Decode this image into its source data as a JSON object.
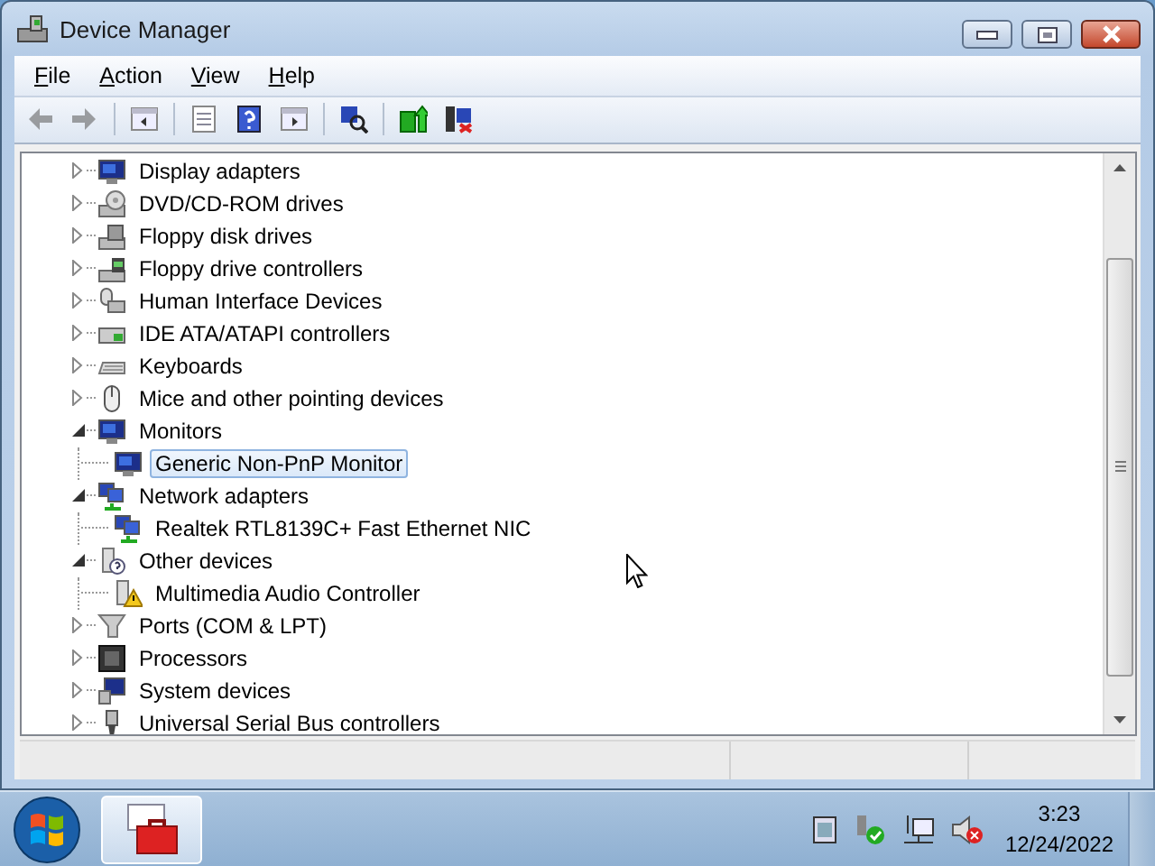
{
  "window": {
    "title": "Device Manager"
  },
  "menu": [
    {
      "label": "File"
    },
    {
      "label": "Action"
    },
    {
      "label": "View"
    },
    {
      "label": "Help"
    }
  ],
  "toolbar": [
    {
      "kind": "back",
      "disabled": true
    },
    {
      "kind": "forward",
      "disabled": true
    },
    {
      "kind": "tree",
      "disabled": false
    },
    {
      "kind": "properties",
      "disabled": false
    },
    {
      "kind": "help",
      "disabled": false
    },
    {
      "kind": "pane",
      "disabled": false
    },
    {
      "kind": "scan",
      "disabled": false
    },
    {
      "kind": "update",
      "disabled": false
    },
    {
      "kind": "uninstall",
      "disabled": false
    }
  ],
  "tree": [
    {
      "label": "Display adapters",
      "expanded": false
    },
    {
      "label": "DVD/CD-ROM drives",
      "expanded": false
    },
    {
      "label": "Floppy disk drives",
      "expanded": false
    },
    {
      "label": "Floppy drive controllers",
      "expanded": false
    },
    {
      "label": "Human Interface Devices",
      "expanded": false
    },
    {
      "label": "IDE ATA/ATAPI controllers",
      "expanded": false
    },
    {
      "label": "Keyboards",
      "expanded": false
    },
    {
      "label": "Mice and other pointing devices",
      "expanded": false
    },
    {
      "label": "Monitors",
      "expanded": true,
      "children": [
        {
          "label": "Generic Non-PnP Monitor",
          "selected": true,
          "warning": false
        }
      ]
    },
    {
      "label": "Network adapters",
      "expanded": true,
      "children": [
        {
          "label": "Realtek RTL8139C+ Fast Ethernet NIC",
          "selected": false,
          "warning": false
        }
      ]
    },
    {
      "label": "Other devices",
      "expanded": true,
      "children": [
        {
          "label": "Multimedia Audio Controller",
          "selected": false,
          "warning": true
        }
      ]
    },
    {
      "label": "Ports (COM & LPT)",
      "expanded": false
    },
    {
      "label": "Processors",
      "expanded": false
    },
    {
      "label": "System devices",
      "expanded": false
    },
    {
      "label": "Universal Serial Bus controllers",
      "expanded": false
    }
  ],
  "taskbar": {
    "app_selected": true,
    "clock": {
      "time": "3:23",
      "date": "12/24/2022"
    }
  }
}
